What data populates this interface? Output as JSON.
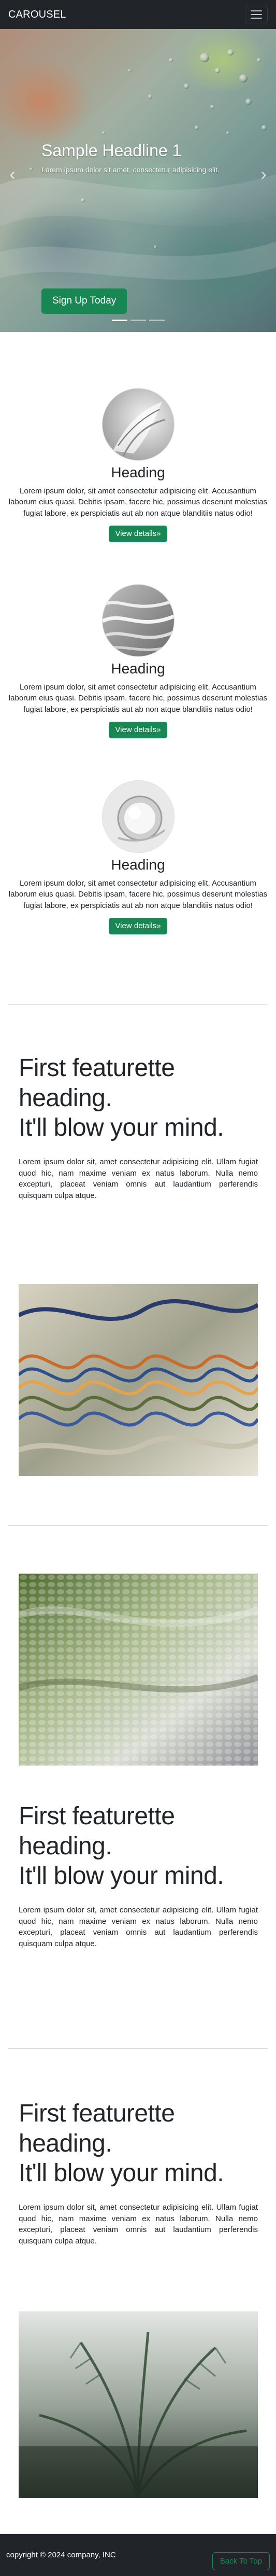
{
  "navbar": {
    "brand": "CAROUSEL",
    "menu_icon": "hamburger-icon"
  },
  "carousel": {
    "headline": "Sample Headline 1",
    "text": "Lorem ipsum dolor sit amet, consectetur adipisicing elit.",
    "button": "Sign Up Today",
    "prev_icon": "chevron-left-icon",
    "next_icon": "chevron-right-icon",
    "slides_count": 3,
    "active_slide": 1
  },
  "marketing": [
    {
      "heading": "Heading",
      "text": "Lorem ipsum dolor, sit amet consectetur adipisicing elit. Accusantium laborum eius quasi. Debitis ipsam, facere hic, possimus deserunt molestias fugiat labore, ex perspiciatis aut ab non atque blanditiis natus odio!",
      "button": "View details»"
    },
    {
      "heading": "Heading",
      "text": "Lorem ipsum dolor, sit amet consectetur adipisicing elit. Accusantium laborum eius quasi. Debitis ipsam, facere hic, possimus deserunt molestias fugiat labore, ex perspiciatis aut ab non atque blanditiis natus odio!",
      "button": "View details»"
    },
    {
      "heading": "Heading",
      "text": "Lorem ipsum dolor, sit amet consectetur adipisicing elit. Accusantium laborum eius quasi. Debitis ipsam, facere hic, possimus deserunt molestias fugiat labore, ex perspiciatis aut ab non atque blanditiis natus odio!",
      "button": "View details»"
    }
  ],
  "featurettes": [
    {
      "heading_line1": "First featurette heading.",
      "heading_line2": "It'll blow your mind.",
      "text": "Lorem ipsum dolor sit, amet consectetur adipisicing elit. Ullam fugiat quod hic, nam maxime veniam ex natus laborum. Nulla nemo excepturi, placeat veniam omnis aut laudantium perferendis quisquam culpa atque."
    },
    {
      "heading_line1": "First featurette heading.",
      "heading_line2": "It'll blow your mind.",
      "text": "Lorem ipsum dolor sit, amet consectetur adipisicing elit. Ullam fugiat quod hic, nam maxime veniam ex natus laborum. Nulla nemo excepturi, placeat veniam omnis aut laudantium perferendis quisquam culpa atque."
    },
    {
      "heading_line1": "First featurette heading.",
      "heading_line2": "It'll blow your mind.",
      "text": "Lorem ipsum dolor sit, amet consectetur adipisicing elit. Ullam fugiat quod hic, nam maxime veniam ex natus laborum. Nulla nemo excepturi, placeat veniam omnis aut laudantium perferendis quisquam culpa atque."
    }
  ],
  "footer": {
    "copyright": "copyright © 2024 company, INC",
    "back_to_top": "Back To Top"
  },
  "colors": {
    "navbar_bg": "#212529",
    "accent_green": "#198754",
    "text": "#212529"
  }
}
